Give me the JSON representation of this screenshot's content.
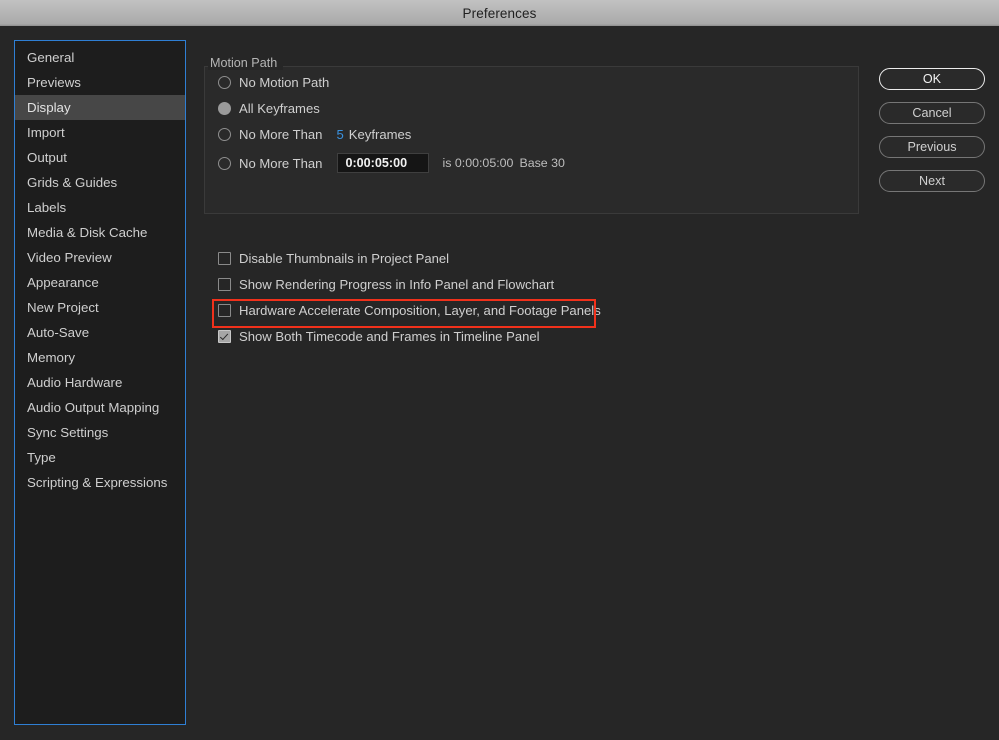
{
  "window": {
    "title": "Preferences"
  },
  "sidebar": {
    "items": [
      {
        "label": "General",
        "selected": false
      },
      {
        "label": "Previews",
        "selected": false
      },
      {
        "label": "Display",
        "selected": true
      },
      {
        "label": "Import",
        "selected": false
      },
      {
        "label": "Output",
        "selected": false
      },
      {
        "label": "Grids & Guides",
        "selected": false
      },
      {
        "label": "Labels",
        "selected": false
      },
      {
        "label": "Media & Disk Cache",
        "selected": false
      },
      {
        "label": "Video Preview",
        "selected": false
      },
      {
        "label": "Appearance",
        "selected": false
      },
      {
        "label": "New Project",
        "selected": false
      },
      {
        "label": "Auto-Save",
        "selected": false
      },
      {
        "label": "Memory",
        "selected": false
      },
      {
        "label": "Audio Hardware",
        "selected": false
      },
      {
        "label": "Audio Output Mapping",
        "selected": false
      },
      {
        "label": "Sync Settings",
        "selected": false
      },
      {
        "label": "Type",
        "selected": false
      },
      {
        "label": "Scripting & Expressions",
        "selected": false
      }
    ]
  },
  "motion_path": {
    "legend": "Motion Path",
    "options": [
      {
        "label": "No Motion Path",
        "selected": false
      },
      {
        "label": "All Keyframes",
        "selected": true
      },
      {
        "label": "No More Than",
        "selected": false
      },
      {
        "label": "No More Than",
        "selected": false
      }
    ],
    "keyframes_value": "5",
    "keyframes_unit": "Keyframes",
    "timecode_value": "0:00:05:00",
    "timecode_placeholder": "0:00:00:00",
    "timecode_note_prefix": "is",
    "timecode_note_value": "0:00:05:00",
    "timecode_note_base": "Base 30"
  },
  "checkboxes": [
    {
      "label": "Disable Thumbnails in Project Panel",
      "checked": false,
      "highlighted": false
    },
    {
      "label": "Show Rendering Progress in Info Panel and Flowchart",
      "checked": false,
      "highlighted": false
    },
    {
      "label": "Hardware Accelerate Composition, Layer, and Footage Panels",
      "checked": false,
      "highlighted": true
    },
    {
      "label": "Show Both Timecode and Frames in Timeline Panel",
      "checked": true,
      "highlighted": false
    }
  ],
  "buttons": [
    {
      "label": "OK",
      "default": true
    },
    {
      "label": "Cancel",
      "default": false
    },
    {
      "label": "Previous",
      "default": false
    },
    {
      "label": "Next",
      "default": false
    }
  ],
  "colors": {
    "background": "#262626",
    "sidebar_background": "#1d1d1d",
    "sidebar_focus_border": "#2f7fd4",
    "selected_row": "#474747",
    "text": "#cfcfcf",
    "accent_blue": "#3a92e0",
    "highlight_red": "#f1311b",
    "titlebar_text": "#1f1f1f"
  }
}
